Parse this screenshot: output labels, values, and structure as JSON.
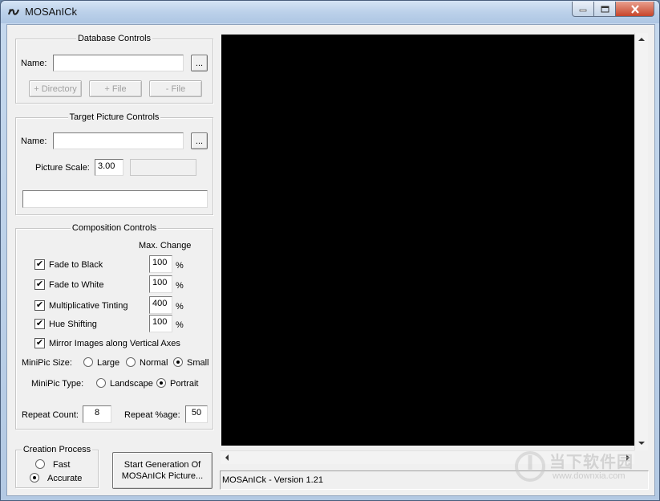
{
  "window": {
    "title": "MOSAnICk"
  },
  "database": {
    "group_title": "Database Controls",
    "name_label": "Name:",
    "name_value": "",
    "browse_label": "...",
    "add_directory_label": "+ Directory",
    "add_file_label": "+ File",
    "remove_file_label": "- File"
  },
  "target": {
    "group_title": "Target Picture Controls",
    "name_label": "Name:",
    "name_value": "",
    "browse_label": "...",
    "scale_label": "Picture Scale:",
    "scale_value": "3.00",
    "scale_info": "",
    "info_value": ""
  },
  "composition": {
    "group_title": "Composition Controls",
    "max_change_label": "Max. Change",
    "percent_symbol": "%",
    "options": [
      {
        "label": "Fade to Black",
        "checked": true,
        "value": "100"
      },
      {
        "label": "Fade to White",
        "checked": true,
        "value": "100"
      },
      {
        "label": "Multiplicative Tinting",
        "checked": true,
        "value": "400"
      },
      {
        "label": "Hue Shifting",
        "checked": true,
        "value": "100"
      }
    ],
    "mirror_label": "Mirror Images along Vertical Axes",
    "mirror_checked": true,
    "minipic_size_label": "MiniPic Size:",
    "size_options": [
      "Large",
      "Normal",
      "Small"
    ],
    "size_selected": "Small",
    "minipic_type_label": "MiniPic Type:",
    "type_options": [
      "Landscape",
      "Portrait"
    ],
    "type_selected": "Portrait",
    "repeat_count_label": "Repeat Count:",
    "repeat_count_value": "8",
    "repeat_pct_label": "Repeat %age:",
    "repeat_pct_value": "50"
  },
  "creation": {
    "group_title": "Creation Process",
    "fast_label": "Fast",
    "accurate_label": "Accurate",
    "selected": "Accurate",
    "start_button_line1": "Start Generation Of",
    "start_button_line2": "MOSAnICk Picture..."
  },
  "status": {
    "text": "MOSAnICk - Version 1.21"
  },
  "watermark": {
    "main": "当下软件园",
    "sub": "www.downxia.com"
  },
  "colors": {
    "canvas": "#000000",
    "titlebar": "#bcd1ea",
    "client": "#f0f0f0",
    "close_button": "#c7452b"
  },
  "icons": {
    "app": "mosaic-app-icon",
    "minimize": "minimize-icon",
    "maximize": "maximize-icon",
    "close": "close-icon"
  }
}
